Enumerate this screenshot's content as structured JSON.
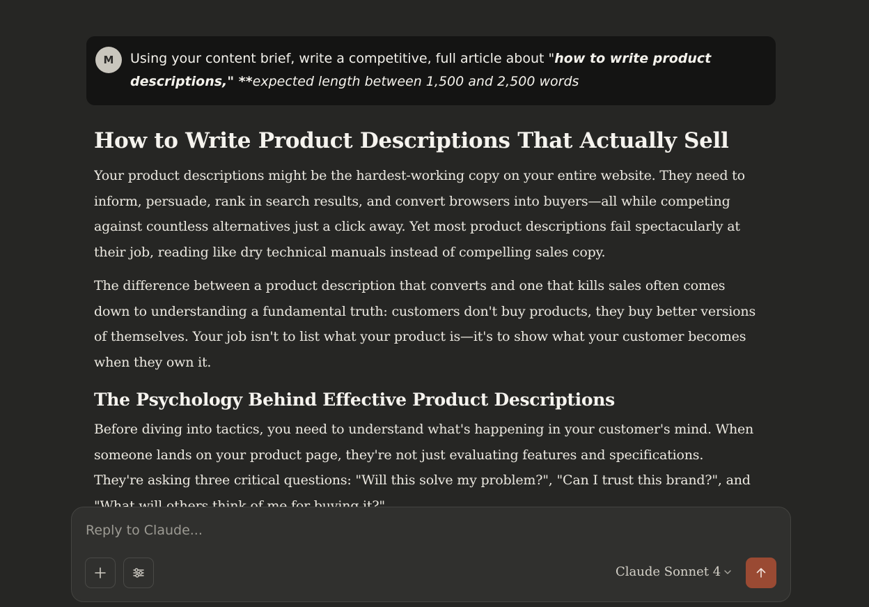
{
  "user_message": {
    "avatar_initial": "M",
    "text_intro": "Using your content brief, write a competitive, full article about \"",
    "text_bold_1": "how to write product",
    "text_bold_2": "descriptions,\" **",
    "text_italic": "expected length between 1,500 and 2,500 words"
  },
  "article": {
    "title": "How to Write Product Descriptions That Actually Sell",
    "paragraphs": [
      "Your product descriptions might be the hardest-working copy on your entire website. They need to inform, persuade, rank in search results, and convert browsers into buyers—all while competing against countless alternatives just a click away. Yet most product descriptions fail spectacularly at their job, reading like dry technical manuals instead of compelling sales copy.",
      "The difference between a product description that converts and one that kills sales often comes down to understanding a fundamental truth: customers don't buy products, they buy better versions of themselves. Your job isn't to list what your product is—it's to show what your customer becomes when they own it."
    ],
    "section_heading": "The Psychology Behind Effective Product Descriptions",
    "section_paragraph": "Before diving into tactics, you need to understand what's happening in your customer's mind. When someone lands on your product page, they're not just evaluating features and specifications. They're asking three critical questions: \"Will this solve my problem?\", \"Can I trust this brand?\", and \"What will others think of me for buying it?\""
  },
  "composer": {
    "placeholder": "Reply to Claude...",
    "model_label": "Claude Sonnet 4",
    "icons": {
      "add": "plus-icon",
      "options": "sliders-icon",
      "model_dropdown": "chevron-down-icon",
      "send": "arrow-up-icon"
    }
  },
  "colors": {
    "background": "#262624",
    "user_bubble": "#141413",
    "composer": "#30302e",
    "send_button": "#9a4a33",
    "text": "#f2f0ea"
  }
}
